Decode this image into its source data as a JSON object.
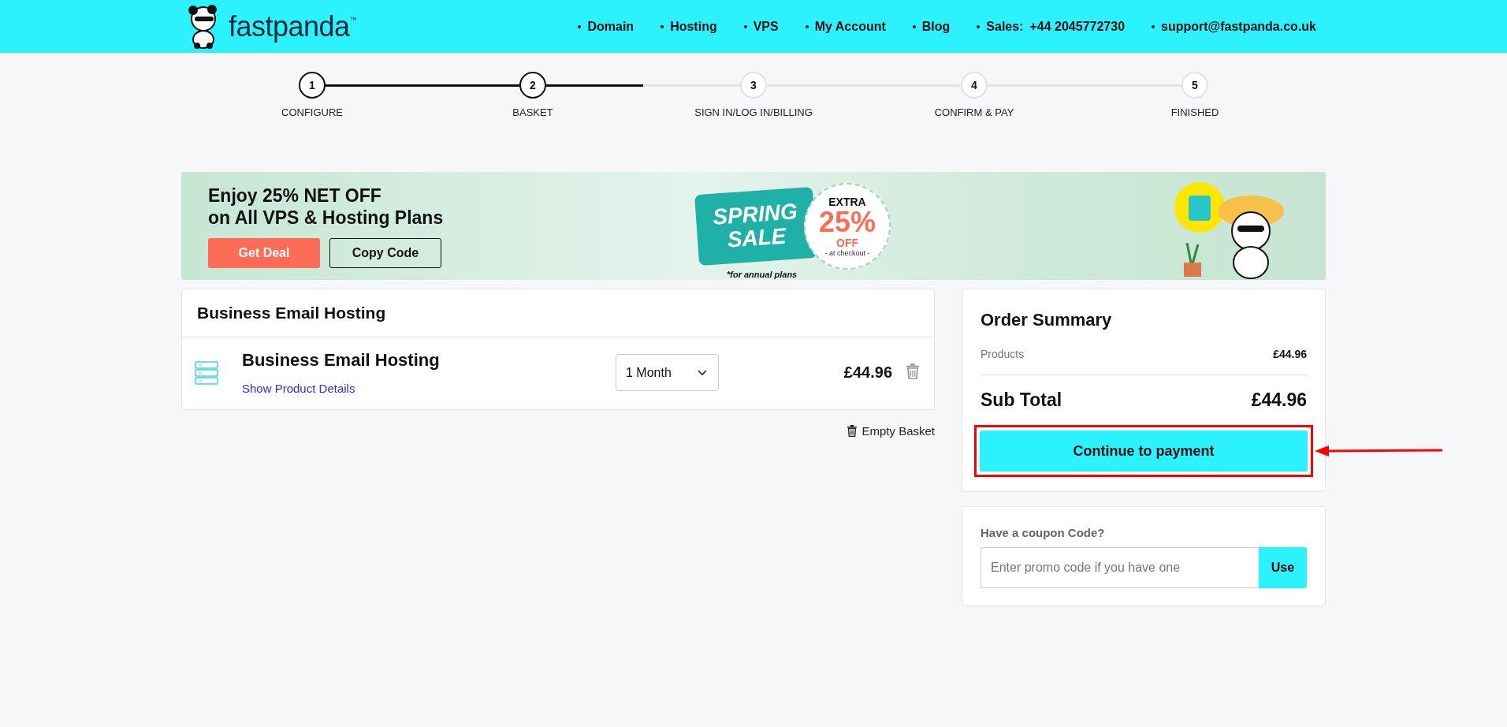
{
  "header": {
    "logo": "fastpanda",
    "trademark": "™",
    "nav": [
      {
        "label": "Domain"
      },
      {
        "label": "Hosting"
      },
      {
        "label": "VPS"
      },
      {
        "label": "My Account"
      },
      {
        "label": "Blog"
      }
    ],
    "sales": {
      "label": "Sales:",
      "phone": "+44 2045772730"
    },
    "email": "support@fastpanda.co.uk"
  },
  "steps": [
    {
      "number": "1",
      "label": "CONFIGURE",
      "completed": true
    },
    {
      "number": "2",
      "label": "BASKET",
      "completed": true
    },
    {
      "number": "3",
      "label": "SIGN IN/LOG IN/BILLING",
      "completed": false
    },
    {
      "number": "4",
      "label": "CONFIRM & PAY",
      "completed": false
    },
    {
      "number": "5",
      "label": "FINISHED",
      "completed": false
    }
  ],
  "banner": {
    "headline": [
      "Enjoy 25% NET OFF",
      "on All VPS & Hosting Plans"
    ],
    "buttons": [
      {
        "label": "Get Deal",
        "kind": "primary"
      },
      {
        "label": "Copy Code",
        "kind": "outline"
      }
    ],
    "sale": {
      "title": [
        "SPRING",
        "SALE"
      ],
      "extra": "EXTRA",
      "percent": "25%",
      "off": "OFF",
      "note": "- at checkout -",
      "footnote": "*for annual plans"
    }
  },
  "basket": {
    "title": "Business Email Hosting",
    "items": [
      {
        "name": "Business Email Hosting",
        "details_link": "Show Product Details",
        "period": "1 Month",
        "price": "£44.96"
      }
    ],
    "empty_label": "Empty Basket"
  },
  "summary": {
    "title": "Order Summary",
    "rows": [
      {
        "label": "Products",
        "value": "£44.96"
      }
    ],
    "subtotal_label": "Sub Total",
    "subtotal": "£44.96",
    "button": "Continue to payment",
    "highlighted": true
  },
  "coupon": {
    "label": "Have a coupon Code?",
    "placeholder": "Enter promo code if you have one",
    "button": "Use"
  }
}
